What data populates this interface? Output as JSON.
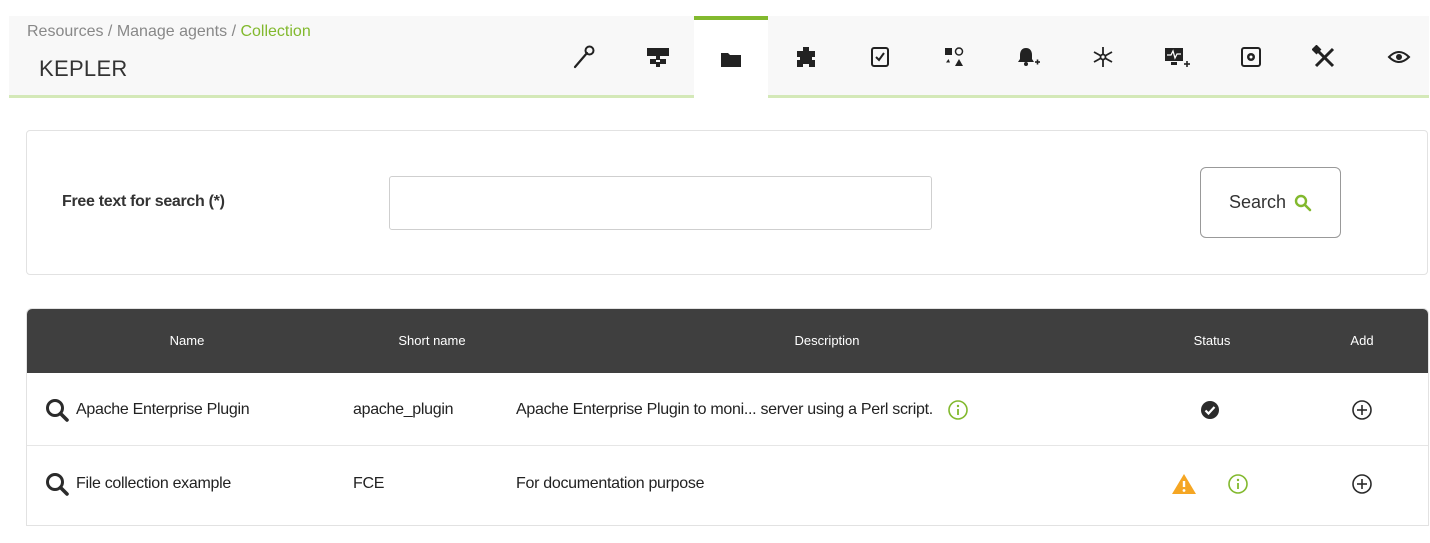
{
  "header": {
    "breadcrumb": {
      "path": "Resources / Manage agents / ",
      "current": "Collection"
    },
    "agent_name": "KEPLER",
    "accent_color": "#82b92e",
    "tabs": [
      {
        "icon": "wrench-setup-icon",
        "active": false
      },
      {
        "icon": "network-tree-icon",
        "active": false
      },
      {
        "icon": "folder-collection-icon",
        "active": true
      },
      {
        "icon": "puzzle-plugin-icon",
        "active": false
      },
      {
        "icon": "checklist-icon",
        "active": false
      },
      {
        "icon": "shapes-icon",
        "active": false
      },
      {
        "icon": "bell-add-icon",
        "active": false
      },
      {
        "icon": "snowflake-icon",
        "active": false
      },
      {
        "icon": "monitor-add-icon",
        "active": false
      },
      {
        "icon": "gear-box-icon",
        "active": false
      },
      {
        "icon": "tools-icon",
        "active": false
      },
      {
        "icon": "eye-icon",
        "active": false
      }
    ]
  },
  "search": {
    "label": "Free text for search (*)",
    "value": "",
    "placeholder": "",
    "button_label": "Search"
  },
  "table": {
    "columns": [
      "Name",
      "Short name",
      "Description",
      "Status",
      "Add"
    ],
    "rows": [
      {
        "name": "Apache Enterprise Plugin",
        "short_name": "apache_plugin",
        "description": "Apache Enterprise Plugin to moni... server using a Perl script.",
        "status_icons": [
          "check-circle-icon"
        ],
        "add_icon": "add-circle-icon"
      },
      {
        "name": "File collection example",
        "short_name": "FCE",
        "description": "For documentation purpose",
        "status_icons": [
          "warning-icon",
          "info-icon"
        ],
        "add_icon": "add-circle-icon"
      }
    ]
  },
  "colors": {
    "header_bg": "#3f3f3f",
    "warning": "#f5a623",
    "info": "#82b92e"
  }
}
